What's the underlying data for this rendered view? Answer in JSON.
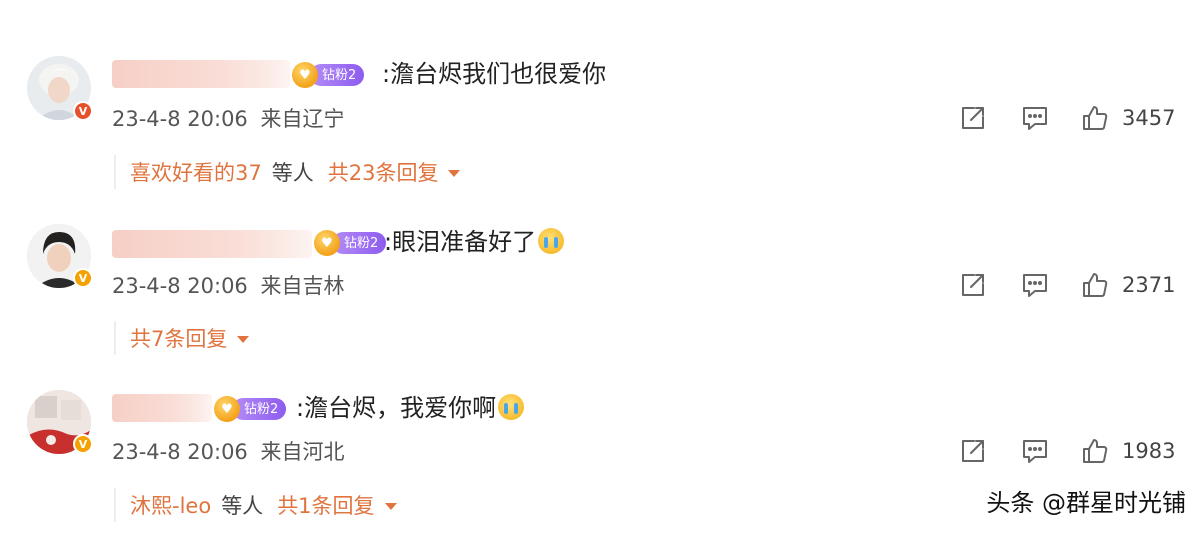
{
  "comments": [
    {
      "fan_badge": "钻粉2",
      "text": ":澹台烬我们也很爱你",
      "time": "23-4-8 20:06",
      "location": "来自辽宁",
      "likes": "3457",
      "reply_liker": "喜欢好看的37",
      "reply_liker_suffix": "等人",
      "reply_total": "共23条回复",
      "verified_badge_color": "#e8502b",
      "emoji": null
    },
    {
      "fan_badge": "钻粉2",
      "text": ":眼泪准备好了",
      "time": "23-4-8 20:06",
      "location": "来自吉林",
      "likes": "2371",
      "reply_total": "共7条回复",
      "verified_badge_color": "#f5a200",
      "emoji": "crying-face"
    },
    {
      "fan_badge": "钻粉2",
      "text": ":澹台烬，我爱你啊",
      "time": "23-4-8 20:06",
      "location": "来自河北",
      "likes": "1983",
      "reply_liker": "沐熙-leo",
      "reply_liker_suffix": "等人",
      "reply_total": "共1条回复",
      "verified_badge_color": "#f5a200",
      "emoji": "crying-face"
    }
  ],
  "icons": {
    "share": "share-icon",
    "comment": "comment-icon",
    "like": "thumbs-up-icon",
    "reply_expand": "caret-down-icon"
  },
  "colors": {
    "accent_orange": "#e0743e",
    "fan_badge_purple": "#8d5cf0",
    "verified_orange": "#f5a200",
    "verified_red": "#e8502b"
  },
  "watermark": "头条 @群星时光铺"
}
